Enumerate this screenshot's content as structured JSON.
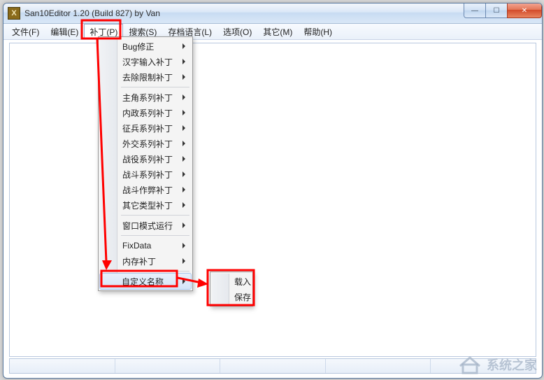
{
  "window": {
    "title": "San10Editor 1.20 (Build 827) by Van",
    "app_icon_letter": "X"
  },
  "caption": {
    "min_glyph": "—",
    "max_glyph": "☐",
    "close_glyph": "✕"
  },
  "menubar": {
    "items": [
      {
        "label": "文件(F)"
      },
      {
        "label": "编辑(E)"
      },
      {
        "label": "补丁(P)",
        "pressed": true
      },
      {
        "label": "搜索(S)"
      },
      {
        "label": "存档语言(L)"
      },
      {
        "label": "选项(O)"
      },
      {
        "label": "其它(M)"
      },
      {
        "label": "帮助(H)"
      }
    ]
  },
  "dropdown_main": {
    "items": [
      {
        "label": "Bug修正",
        "submenu": true
      },
      {
        "label": "汉字输入补丁",
        "submenu": true
      },
      {
        "label": "去除限制补丁",
        "submenu": true
      },
      {
        "sep": true
      },
      {
        "label": "主角系列补丁",
        "submenu": true
      },
      {
        "label": "内政系列补丁",
        "submenu": true
      },
      {
        "label": "征兵系列补丁",
        "submenu": true
      },
      {
        "label": "外交系列补丁",
        "submenu": true
      },
      {
        "label": "战役系列补丁",
        "submenu": true
      },
      {
        "label": "战斗系列补丁",
        "submenu": true
      },
      {
        "label": "战斗作弊补丁",
        "submenu": true
      },
      {
        "label": "其它类型补丁",
        "submenu": true
      },
      {
        "sep": true
      },
      {
        "label": "窗口模式运行",
        "submenu": true
      },
      {
        "sep": true
      },
      {
        "label": "FixData",
        "submenu": true
      },
      {
        "label": "内存补丁",
        "submenu": true
      },
      {
        "sep": true
      },
      {
        "label": "自定义名称",
        "submenu": true,
        "hover": true
      }
    ]
  },
  "dropdown_sub": {
    "items": [
      {
        "label": "载入"
      },
      {
        "label": "保存"
      }
    ]
  },
  "watermark": "系统之家"
}
